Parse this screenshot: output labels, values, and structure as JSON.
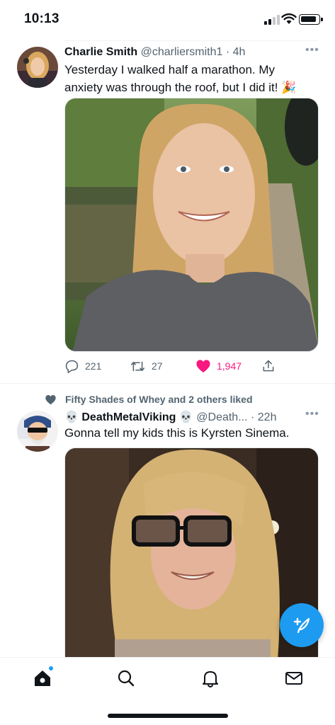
{
  "status_bar": {
    "time": "10:13"
  },
  "tweets": [
    {
      "name": "Charlie Smith",
      "handle": "@charliersmith1",
      "time": "4h",
      "text_line1": "Yesterday I walked half a marathon. My",
      "text_line2": "anxiety was through the roof, but I did it! 🎉",
      "replies": "221",
      "retweets": "27",
      "likes": "1,947"
    },
    {
      "social_context": "Fifty Shades of Whey and 2 others liked",
      "name": "💀 DeathMetalViking 💀",
      "handle": "@Death...",
      "time": "22h",
      "text": "Gonna tell my kids this is Kyrsten Sinema."
    }
  ],
  "colors": {
    "accent": "#1d9bf0",
    "like": "#f91880",
    "secondary_text": "#536471"
  },
  "icons": {
    "reply": "reply-icon",
    "retweet": "retweet-icon",
    "like": "heart-icon",
    "share": "share-icon",
    "compose": "compose-tweet-icon",
    "home": "home-icon",
    "search": "search-icon",
    "notifications": "bell-icon",
    "messages": "mail-icon"
  }
}
